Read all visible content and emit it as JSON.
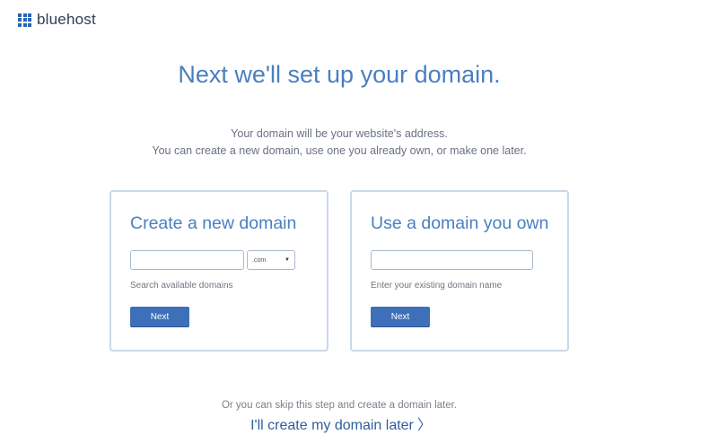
{
  "header": {
    "brand": "bluehost"
  },
  "main": {
    "headline": "Next we'll set up your domain.",
    "intro_line1": "Your domain will be your website's address.",
    "intro_line2": "You can create a new domain, use one you already own, or make one later."
  },
  "new_domain": {
    "title": "Create a new domain",
    "input_value": "",
    "tld_selected": ".com",
    "helper": "Search available domains",
    "button_label": "Next"
  },
  "own_domain": {
    "title": "Use a domain you own",
    "input_value": "",
    "helper": "Enter your existing domain name",
    "button_label": "Next"
  },
  "footer": {
    "skip_text": "Or you can skip this step and create a domain later.",
    "later_link": "I'll create my domain later",
    "later_chevron": "〉"
  },
  "colors": {
    "brand_blue": "#2a64b5",
    "headline_blue": "#4a7fbf",
    "button_blue": "#3d70b8",
    "card_border": "#c9d8ea"
  },
  "icons": {
    "logo": "grid-logo-icon",
    "dropdown": "caret-down-icon",
    "link": "chevron-right-icon"
  }
}
